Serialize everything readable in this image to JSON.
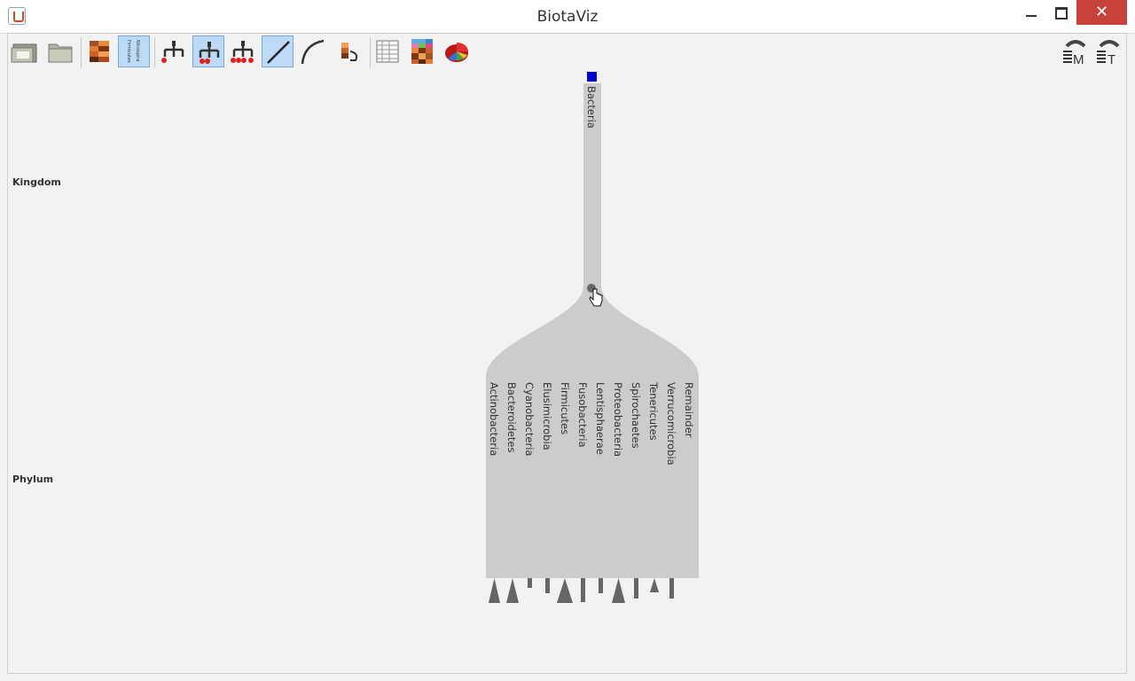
{
  "window": {
    "title": "BiotaViz"
  },
  "controls": {
    "minimize": "",
    "maximize": "",
    "close": "✕"
  },
  "toolbar": {
    "mini_icon_label_top": "Nitrospira",
    "mini_icon_label_bottom": "Firmicutes"
  },
  "ranks": [
    "Kingdom",
    "Phylum"
  ],
  "tree": {
    "root": "Bacteria",
    "phyla": [
      "Actinobacteria",
      "Bacteroidetes",
      "Cyanobacteria",
      "Elusimicrobia",
      "Firmicutes",
      "Fusobacteria",
      "Lentisphaerae",
      "Proteobacteria",
      "Spirochaetes",
      "Tenericutes",
      "Verrucomicrobia",
      "Remainder"
    ],
    "root_color": "#0000cc",
    "fill_color": "#cccccc",
    "marker_color": "#666666"
  }
}
